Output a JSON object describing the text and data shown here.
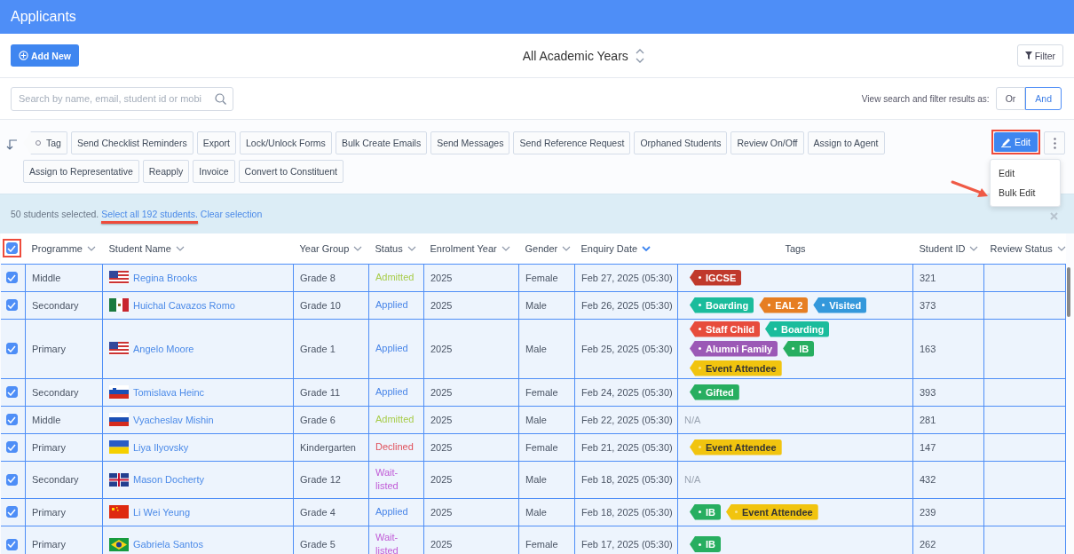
{
  "header": {
    "title": "Applicants"
  },
  "toolbar": {
    "add_button": "Add New",
    "year_selector": "All Academic Years",
    "filter_button": "Filter"
  },
  "search": {
    "placeholder": "Search by name, email, student id or mobi",
    "match_label": "View search and filter results as:",
    "match_options": [
      {
        "label": "Or",
        "selected": false
      },
      {
        "label": "And",
        "selected": true
      }
    ]
  },
  "actions": {
    "tag_button": "Tag",
    "buttons": [
      "Send Checklist Reminders",
      "Export",
      "Lock/Unlock Forms",
      "Bulk Create Emails",
      "Send Messages",
      "Send Reference Request",
      "Orphaned Students",
      "Review On/Off",
      "Assign to Agent",
      "Assign to Representative",
      "Reapply",
      "Invoice",
      "Convert to Constituent"
    ],
    "edit_button": "Edit",
    "menu": {
      "items": [
        "Edit",
        "Bulk Edit"
      ]
    }
  },
  "selection_bar": {
    "text": "50 students selected.",
    "select_all_link": "Select all 192 students.",
    "clear_link": "Clear selection"
  },
  "table": {
    "select_all_checked": true,
    "columns": [
      {
        "label": "Programme",
        "sortable": true,
        "sorted": false
      },
      {
        "label": "Student Name",
        "sortable": true,
        "sorted": false
      },
      {
        "label": "Year Group",
        "sortable": true,
        "sorted": false
      },
      {
        "label": "Status",
        "sortable": true,
        "sorted": false
      },
      {
        "label": "Enrolment Year",
        "sortable": true,
        "sorted": false
      },
      {
        "label": "Gender",
        "sortable": true,
        "sorted": false
      },
      {
        "label": "Enquiry Date",
        "sortable": true,
        "sorted": true
      },
      {
        "label": "Tags",
        "sortable": false,
        "sorted": false
      },
      {
        "label": "Student ID",
        "sortable": true,
        "sorted": false
      },
      {
        "label": "Review Status",
        "sortable": true,
        "sorted": false
      }
    ],
    "rows": [
      {
        "checked": true,
        "programme": "Middle",
        "flag": {
          "kind": "us"
        },
        "name": "Regina Brooks",
        "year_group": "Grade 8",
        "status": {
          "text": "Admitted",
          "color": "#a8cc4a"
        },
        "enrolment_year": "2025",
        "gender": "Female",
        "enquiry_date": "Feb 27, 2025 (05:30)",
        "tags": [
          {
            "label": "IGCSE",
            "color": "#c0392b"
          }
        ],
        "student_id": "321"
      },
      {
        "checked": true,
        "programme": "Secondary",
        "flag": {
          "kind": "mx"
        },
        "name": "Huichal Cavazos Romo",
        "year_group": "Grade 10",
        "status": {
          "text": "Applied",
          "color": "#4a86e8"
        },
        "enrolment_year": "2025",
        "gender": "Male",
        "enquiry_date": "Feb 26, 2025 (05:30)",
        "tags": [
          {
            "label": "Boarding",
            "color": "#1abc9c"
          },
          {
            "label": "EAL 2",
            "color": "#e67e22"
          },
          {
            "label": "Visited",
            "color": "#3498db"
          }
        ],
        "student_id": "373"
      },
      {
        "checked": true,
        "programme": "Primary",
        "flag": {
          "kind": "us"
        },
        "name": "Angelo Moore",
        "year_group": "Grade 1",
        "status": {
          "text": "Applied",
          "color": "#4a86e8"
        },
        "enrolment_year": "2025",
        "gender": "Male",
        "enquiry_date": "Feb 25, 2025 (05:30)",
        "tags": [
          {
            "label": "Staff Child",
            "color": "#e74c3c"
          },
          {
            "label": "Boarding",
            "color": "#1abc9c"
          },
          {
            "label": "Alumni Family",
            "color": "#9b59b6"
          },
          {
            "label": "IB",
            "color": "#27ae60"
          },
          {
            "label": "Event Attendee",
            "color": "#f1c40f"
          }
        ],
        "student_id": "163"
      },
      {
        "checked": true,
        "programme": "Secondary",
        "flag": {
          "kind": "si"
        },
        "name": "Tomislava Heinc",
        "year_group": "Grade 11",
        "status": {
          "text": "Applied",
          "color": "#4a86e8"
        },
        "enrolment_year": "2025",
        "gender": "Female",
        "enquiry_date": "Feb 24, 2025 (05:30)",
        "tags": [
          {
            "label": "Gifted",
            "color": "#27ae60"
          }
        ],
        "student_id": "393"
      },
      {
        "checked": true,
        "programme": "Middle",
        "flag": {
          "kind": "ru"
        },
        "name": "Vyacheslav Mishin",
        "year_group": "Grade 6",
        "status": {
          "text": "Admitted",
          "color": "#a8cc4a"
        },
        "enrolment_year": "2025",
        "gender": "Male",
        "enquiry_date": "Feb 22, 2025 (05:30)",
        "tags_placeholder": "N/A",
        "student_id": "281"
      },
      {
        "checked": true,
        "programme": "Primary",
        "flag": {
          "kind": "ua"
        },
        "name": "Liya Ilyovsky",
        "year_group": "Kindergarten",
        "status": {
          "text": "Declined",
          "color": "#e0505a"
        },
        "enrolment_year": "2025",
        "gender": "Female",
        "enquiry_date": "Feb 21, 2025 (05:30)",
        "tags": [
          {
            "label": "Event Attendee",
            "color": "#f1c40f"
          }
        ],
        "student_id": "147"
      },
      {
        "checked": true,
        "programme": "Secondary",
        "flag": {
          "kind": "gb"
        },
        "name": "Mason Docherty",
        "year_group": "Grade 12",
        "status": {
          "text": "Wait-listed",
          "color": "#c05ad6"
        },
        "enrolment_year": "2025",
        "gender": "Male",
        "enquiry_date": "Feb 18, 2025 (05:30)",
        "tags_placeholder": "N/A",
        "student_id": "432"
      },
      {
        "checked": true,
        "programme": "Primary",
        "flag": {
          "kind": "cn"
        },
        "name": "Li Wei Yeung",
        "year_group": "Grade 4",
        "status": {
          "text": "Applied",
          "color": "#4a86e8"
        },
        "enrolment_year": "2025",
        "gender": "Male",
        "enquiry_date": "Feb 18, 2025 (05:30)",
        "tags": [
          {
            "label": "IB",
            "color": "#27ae60"
          },
          {
            "label": "Event Attendee",
            "color": "#f1c40f"
          }
        ],
        "student_id": "239"
      },
      {
        "checked": true,
        "programme": "Primary",
        "flag": {
          "kind": "br"
        },
        "name": "Gabriela Santos",
        "year_group": "Grade 5",
        "status": {
          "text": "Wait-listed",
          "color": "#c05ad6"
        },
        "enrolment_year": "2025",
        "gender": "Female",
        "enquiry_date": "Feb 17, 2025 (05:30)",
        "tags": [
          {
            "label": "IB",
            "color": "#27ae60"
          }
        ],
        "student_id": "262"
      }
    ]
  }
}
